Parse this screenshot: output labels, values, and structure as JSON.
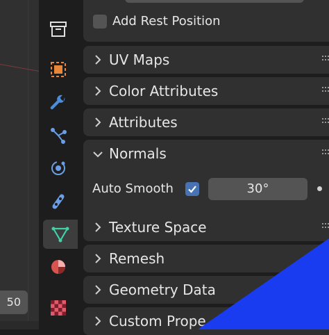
{
  "viewport": {
    "value_text": "50"
  },
  "tabs": [
    {
      "name": "scene-tab",
      "icon": "archive-box-icon"
    },
    {
      "name": "object-tab",
      "icon": "orange-square-icon"
    },
    {
      "name": "modifiers-tab",
      "icon": "wrench-icon"
    },
    {
      "name": "particles-tab",
      "icon": "particles-icon"
    },
    {
      "name": "physics-tab",
      "icon": "physics-orbit-icon"
    },
    {
      "name": "constraints-tab",
      "icon": "constraint-icon"
    },
    {
      "name": "data-tab",
      "icon": "mesh-data-triangle-icon",
      "active": true
    },
    {
      "name": "material-tab",
      "icon": "material-sphere-icon"
    },
    {
      "name": "texture-tab",
      "icon": "checker-texture-icon"
    }
  ],
  "properties": {
    "rest_position_label": "Add Rest Position",
    "panels": {
      "uv_maps": "UV Maps",
      "color_attributes": "Color Attributes",
      "attributes": "Attributes",
      "normals": "Normals",
      "texture_space": "Texture Space",
      "remesh": "Remesh",
      "geometry_data": "Geometry Data",
      "custom_properties": "Custom Prope"
    },
    "normals": {
      "auto_smooth_label": "Auto Smooth",
      "auto_smooth_checked": true,
      "angle_value": "30°"
    }
  },
  "colors": {
    "accent_blue": "#4772b3",
    "overlay_blue": "#1a3cf0",
    "data_tab_green": "#3fd1a8",
    "object_orange": "#e8873a",
    "modifier_blue": "#4c8ddb"
  }
}
